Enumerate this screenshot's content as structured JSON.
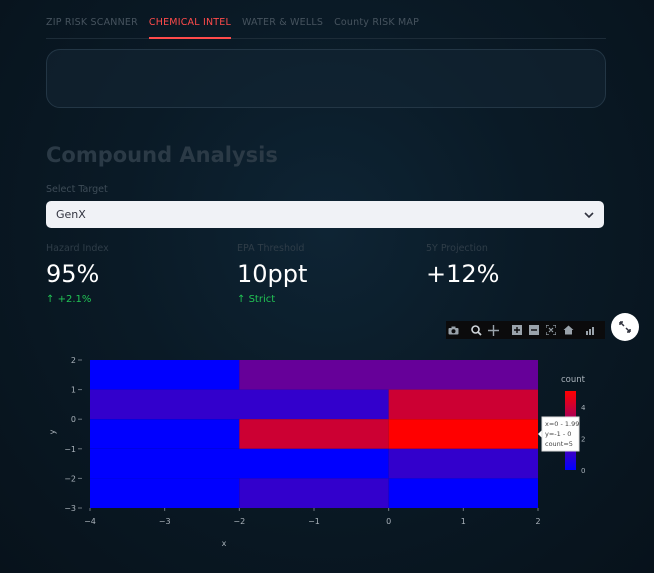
{
  "tabs": [
    "ZIP RISK SCANNER",
    "CHEMICAL INTEL",
    "WATER & WELLS",
    "County RISK MAP"
  ],
  "active_tab": 1,
  "heading": "Compound Analysis",
  "select": {
    "label": "Select Target",
    "value": "GenX"
  },
  "metrics": [
    {
      "label": "Hazard Index",
      "value": "95%",
      "delta": "+2.1%"
    },
    {
      "label": "EPA Threshold",
      "value": "10ppt",
      "delta": "Strict"
    },
    {
      "label": "5Y Projection",
      "value": "+12%",
      "delta": ""
    }
  ],
  "colors": {
    "accent": "#ff4b4b",
    "delta_up": "#21c354",
    "count_low": "#0000ff",
    "count_high": "#ff0000"
  },
  "toolbar_icons": [
    "camera-icon",
    "zoom-icon",
    "pan-icon",
    "zoom-in-icon",
    "zoom-out-icon",
    "autoscale-icon",
    "home-icon",
    "plotly-logo-icon"
  ],
  "chart_data": {
    "type": "heatmap",
    "xlabel": "x",
    "ylabel": "y",
    "xlim": [
      -4,
      2
    ],
    "ylim": [
      -3,
      2
    ],
    "x_ticks": [
      "-4",
      "-3",
      "-2",
      "-1",
      "0",
      "1",
      "2"
    ],
    "y_ticks": [
      "2",
      "1",
      "0",
      "-1",
      "-2",
      "-3"
    ],
    "legend_title": "count",
    "colorbar_ticks": [
      "4",
      "2",
      "0"
    ],
    "zrange": [
      0,
      5
    ],
    "cells": [
      {
        "x0": -4,
        "x1": -2,
        "y0": 1,
        "y1": 2,
        "count": 0
      },
      {
        "x0": -2,
        "x1": 2,
        "y0": 1,
        "y1": 2,
        "count": 2
      },
      {
        "x0": -4,
        "x1": 0,
        "y0": 0,
        "y1": 1,
        "count": 1
      },
      {
        "x0": 0,
        "x1": 2,
        "y0": 0,
        "y1": 1,
        "count": 4
      },
      {
        "x0": -4,
        "x1": -2,
        "y0": -1,
        "y1": 0,
        "count": 0
      },
      {
        "x0": -2,
        "x1": 0,
        "y0": -1,
        "y1": 0,
        "count": 4
      },
      {
        "x0": 0,
        "x1": 2,
        "y0": -1,
        "y1": 0,
        "count": 5
      },
      {
        "x0": -4,
        "x1": 0,
        "y0": -2,
        "y1": -1,
        "count": 0
      },
      {
        "x0": 0,
        "x1": 2,
        "y0": -2,
        "y1": -1,
        "count": 1
      },
      {
        "x0": -4,
        "x1": -2,
        "y0": -3,
        "y1": -2,
        "count": 0
      },
      {
        "x0": -2,
        "x1": 0,
        "y0": -3,
        "y1": -2,
        "count": 1
      },
      {
        "x0": 0,
        "x1": 2,
        "y0": -3,
        "y1": -2,
        "count": 0
      }
    ],
    "tooltip": {
      "lines": [
        "x=0 - 1.99",
        "y=-1 - 0",
        "count=5"
      ]
    }
  }
}
